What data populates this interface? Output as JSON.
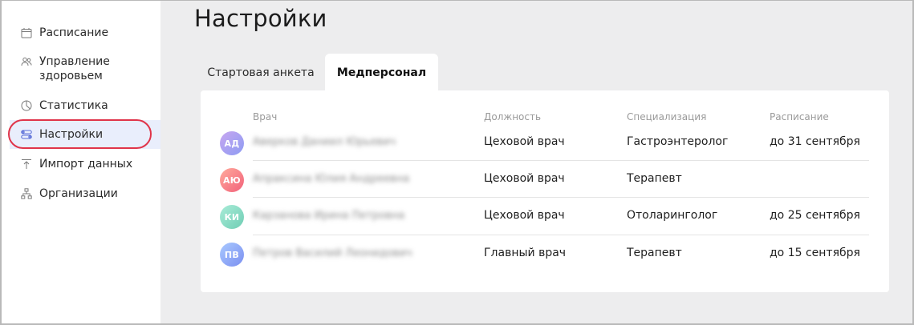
{
  "sidebar": {
    "items": [
      {
        "label": "Расписание",
        "icon": "calendar-icon"
      },
      {
        "label": "Управление здоровьем",
        "icon": "people-icon"
      },
      {
        "label": "Статистика",
        "icon": "pie-chart-icon"
      },
      {
        "label": "Настройки",
        "icon": "sliders-icon",
        "active": true
      },
      {
        "label": "Импорт данных",
        "icon": "upload-icon"
      },
      {
        "label": "Организации",
        "icon": "org-structure-icon"
      }
    ],
    "active_ring_color": "#e0344a",
    "active_bg_color": "#e9eefc"
  },
  "page": {
    "title": "Настройки"
  },
  "tabs": [
    {
      "label": "Стартовая анкета",
      "active": false
    },
    {
      "label": "Медперсонал",
      "active": true
    }
  ],
  "table": {
    "headers": [
      "Врач",
      "Должность",
      "Специализация",
      "Расписание"
    ],
    "rows": [
      {
        "initials": "АД",
        "name": "Аверков Даниил Юрьевич",
        "position": "Цеховой врач",
        "specialization": "Гастроэнтеролог",
        "schedule": "до 31 сентября",
        "avatar_from": "#c7a6f0",
        "avatar_to": "#8d9cf3"
      },
      {
        "initials": "АЮ",
        "name": "Апраксина Юлия Андреевна",
        "position": "Цеховой врач",
        "specialization": "Терапевт",
        "schedule": "",
        "avatar_from": "#ffab9c",
        "avatar_to": "#f2617a"
      },
      {
        "initials": "КИ",
        "name": "Карзанова Ирина Петровна",
        "position": "Цеховой врач",
        "specialization": "Отоларинголог",
        "schedule": "до 25 сентября",
        "avatar_from": "#a9ecd8",
        "avatar_to": "#6fcdb4"
      },
      {
        "initials": "ПВ",
        "name": "Петров Василий Леонидович",
        "position": "Главный врач",
        "specialization": "Терапевт",
        "schedule": "до 15 сентября",
        "avatar_from": "#a9c9ff",
        "avatar_to": "#7b8ff0"
      }
    ]
  }
}
